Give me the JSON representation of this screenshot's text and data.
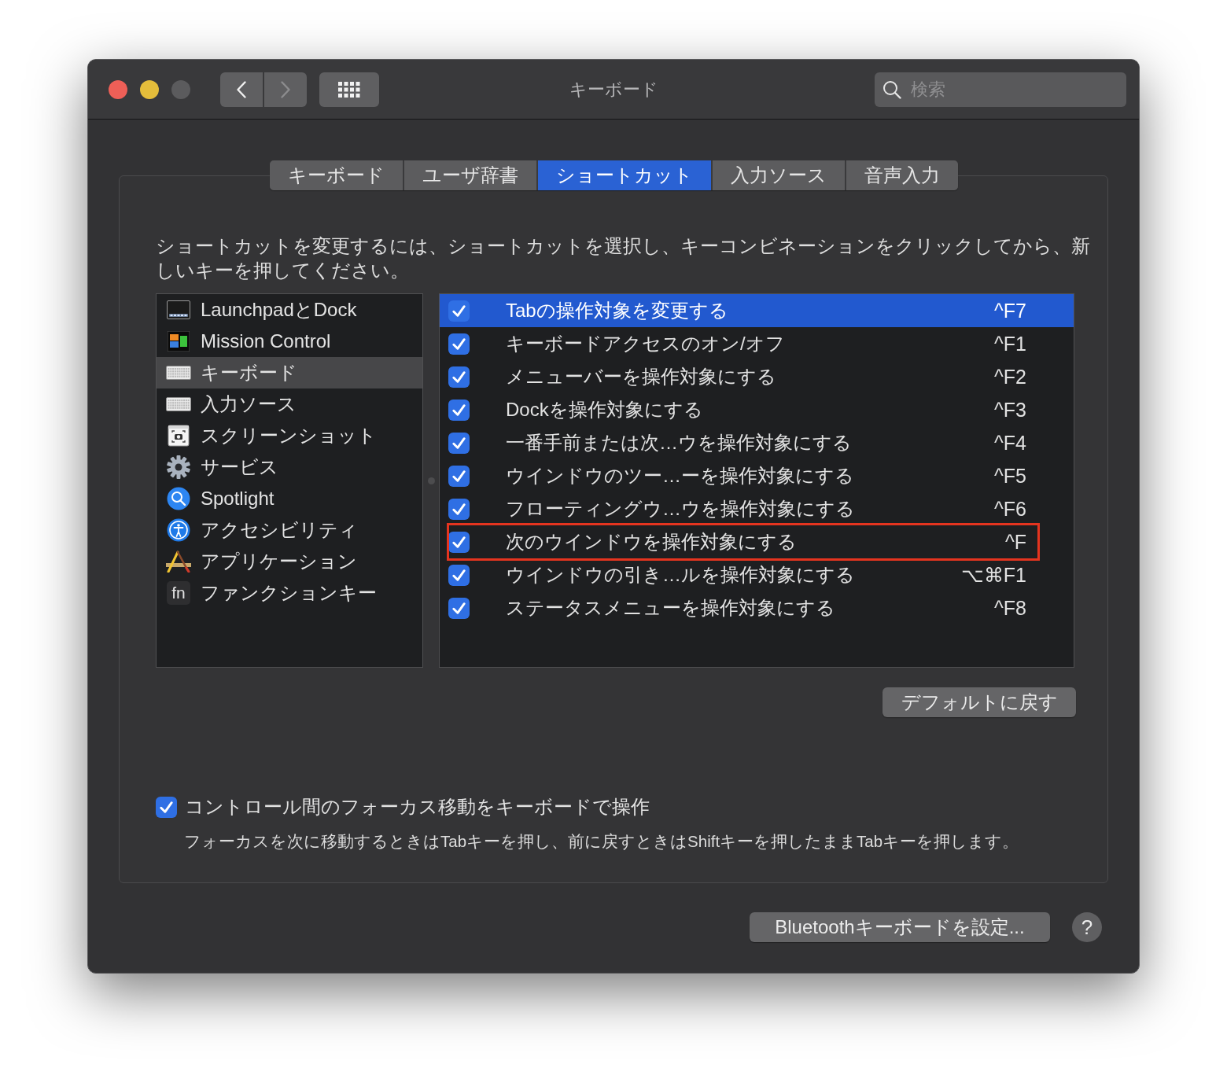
{
  "window": {
    "title": "キーボード",
    "zoom_disabled": true
  },
  "toolbar": {
    "back": {
      "disabled": false
    },
    "forward": {
      "disabled": true
    },
    "search": {
      "placeholder": "検索"
    }
  },
  "tabs": [
    {
      "label": "キーボード",
      "selected": false
    },
    {
      "label": "ユーザ辞書",
      "selected": false
    },
    {
      "label": "ショートカット",
      "selected": true
    },
    {
      "label": "入力ソース",
      "selected": false
    },
    {
      "label": "音声入力",
      "selected": false
    }
  ],
  "description": "ショートカットを変更するには、ショートカットを選択し、キーコンビネーションをクリックしてから、新しいキーを押してください。",
  "categories": [
    {
      "label": "LaunchpadとDock",
      "selected": false
    },
    {
      "label": "Mission Control",
      "selected": false
    },
    {
      "label": "キーボード",
      "selected": true
    },
    {
      "label": "入力ソース",
      "selected": false
    },
    {
      "label": "スクリーンショット",
      "selected": false
    },
    {
      "label": "サービス",
      "selected": false
    },
    {
      "label": "Spotlight",
      "selected": false
    },
    {
      "label": "アクセシビリティ",
      "selected": false
    },
    {
      "label": "アプリケーション",
      "selected": false
    },
    {
      "label": "ファンクションキー",
      "selected": false,
      "icon_text": "fn"
    }
  ],
  "shortcuts": [
    {
      "label": "Tabの操作対象を変更する",
      "keys": "^F7",
      "checked": true,
      "selected": true,
      "outlined": false
    },
    {
      "label": "キーボードアクセスのオン/オフ",
      "keys": "^F1",
      "checked": true,
      "selected": false,
      "outlined": false
    },
    {
      "label": "メニューバーを操作対象にする",
      "keys": "^F2",
      "checked": true,
      "selected": false,
      "outlined": false
    },
    {
      "label": "Dockを操作対象にする",
      "keys": "^F3",
      "checked": true,
      "selected": false,
      "outlined": false
    },
    {
      "label": "一番手前または次…ウを操作対象にする",
      "keys": "^F4",
      "checked": true,
      "selected": false,
      "outlined": false
    },
    {
      "label": "ウインドウのツー…ーを操作対象にする",
      "keys": "^F5",
      "checked": true,
      "selected": false,
      "outlined": false
    },
    {
      "label": "フローティングウ…ウを操作対象にする",
      "keys": "^F6",
      "checked": true,
      "selected": false,
      "outlined": false
    },
    {
      "label": "次のウインドウを操作対象にする",
      "keys": "^F",
      "checked": true,
      "selected": false,
      "outlined": true
    },
    {
      "label": "ウインドウの引き…ルを操作対象にする",
      "keys": "⌥⌘F1",
      "checked": true,
      "selected": false,
      "outlined": false
    },
    {
      "label": "ステータスメニューを操作対象にする",
      "keys": "^F8",
      "checked": true,
      "selected": false,
      "outlined": false
    }
  ],
  "reset_button": "デフォルトに戻す",
  "keyboard_navigation": {
    "label": "コントロール間のフォーカス移動をキーボードで操作",
    "checked": true,
    "hint": "フォーカスを次に移動するときはTabキーを押し、前に戻すときはShiftキーを押したままTabキーを押します。"
  },
  "footer": {
    "bluetooth_button": "Bluetoothキーボードを設定...",
    "help_button": "?"
  }
}
